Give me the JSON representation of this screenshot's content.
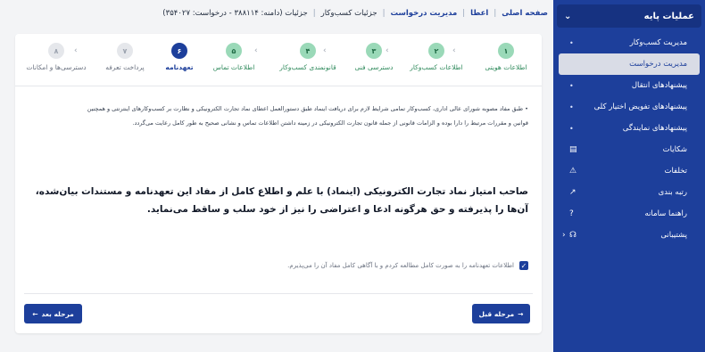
{
  "breadcrumb": {
    "home": "صفحه اصلی",
    "enamad": "اعطا",
    "requests": "مدیریت درخواست",
    "current": "جزئیات کسب‌وکار",
    "details": "جزئیات (دامنه: ۳۸۸۱۱۴ - درخواست: ۳۵۴۰۲۷)"
  },
  "sidebar": {
    "header": "عملیات پایه",
    "sub_items": [
      {
        "label": "مدیریت کسب‌وکار"
      },
      {
        "label": "مدیریت درخواست"
      },
      {
        "label": "پیشنهادهای انتقال"
      },
      {
        "label": "پیشنهادهای تفویض اختیار کلی"
      },
      {
        "label": "پیشنهادهای نمایندگی"
      }
    ],
    "items": [
      {
        "label": "شکایات",
        "icon": "document-icon"
      },
      {
        "label": "تخلفات",
        "icon": "warning-icon"
      },
      {
        "label": "رتبه بندی",
        "icon": "trend-icon"
      },
      {
        "label": "راهنما سامانه",
        "icon": "help-icon"
      },
      {
        "label": "پشتیبانی",
        "icon": "headset-icon"
      }
    ]
  },
  "steps": [
    {
      "num": "۱",
      "label": "اطلاعات هویتی",
      "state": "done"
    },
    {
      "num": "۲",
      "label": "اطلاعات کسب‌وکار",
      "state": "done"
    },
    {
      "num": "۳",
      "label": "دسترسی فنی",
      "state": "done"
    },
    {
      "num": "۴",
      "label": "قانونمندی کسب‌وکار",
      "state": "done"
    },
    {
      "num": "۵",
      "label": "اطلاعات تماس",
      "state": "done"
    },
    {
      "num": "۶",
      "label": "تعهدنامه",
      "state": "current"
    },
    {
      "num": "۷",
      "label": "پرداخت تعرفه",
      "state": "future"
    },
    {
      "num": "۸",
      "label": "دسترسی‌ها و امکانات",
      "state": "future"
    }
  ],
  "content": {
    "bullet_1": "• طبق مفاد مصوبه شورای عالی اداری، کسب‌وکار تمامی شرایط لازم برای دریافت اینماد طبق دستورالعمل اعطای نماد تجارت الکترونیکی و نظارت بر کسب‌وکارهای اینترنتی و همچنین",
    "bullet_1_cont": "قوانین و مقررات مرتبط را دارا بوده و الزامات قانونی از جمله قانون تجارت الکترونیکی در زمینه داشتن اطلاعات تماس و نشانی صحیح به طور کامل رعایت می‌گردد.",
    "statement": "صاحب امتیاز نماد تجارت الکترونیکی (اینماد) با علم و اطلاع کامل از مفاد این تعهدنامه و مستندات بیان‌شده، آن‌ها را پذیرفته و حق هرگونه ادعا و اعتراضی را نیز از خود سلب و ساقط می‌نماید.",
    "confirm_label": "اطلاعات تعهدنامه را به صورت کامل مطالعه کردم و با آگاهی کامل مفاد آن را می‌پذیرم."
  },
  "buttons": {
    "prev": "مرحله قبل",
    "next": "مرحله بعد"
  },
  "colors": {
    "primary": "#1d3f9b",
    "done_step": "#9ad9b8"
  }
}
